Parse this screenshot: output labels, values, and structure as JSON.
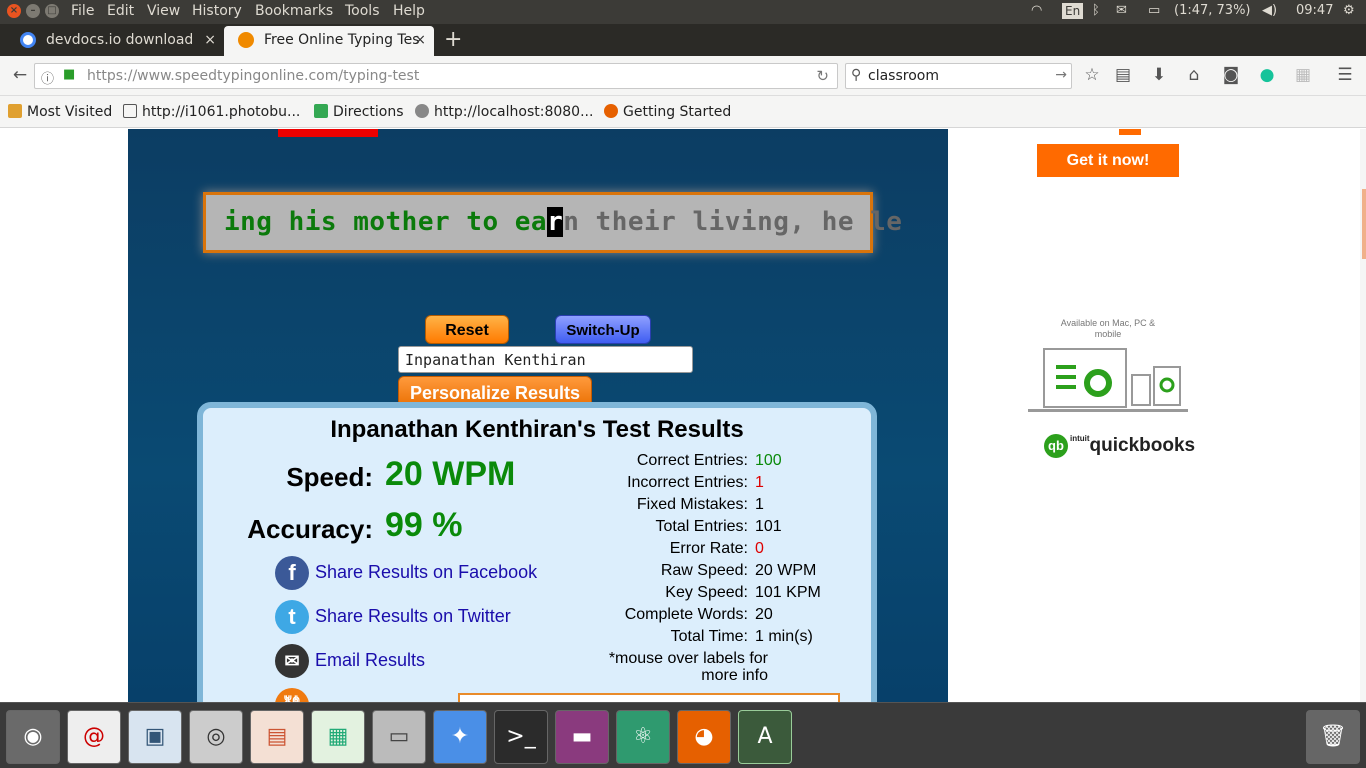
{
  "system_menu": {
    "items": [
      "File",
      "Edit",
      "View",
      "History",
      "Bookmarks",
      "Tools",
      "Help"
    ],
    "tray": {
      "keyboard": "En",
      "battery": "(1:47, 73%)",
      "time": "09:47"
    }
  },
  "tabs": [
    {
      "title": "devdocs.io download",
      "active": false
    },
    {
      "title": "Free Online Typing Tes",
      "active": true
    }
  ],
  "nav": {
    "url_domain": "https://www.speedtypingonline.com",
    "url_path": "/typing-test",
    "search_value": "classroom"
  },
  "bookmarks": [
    "Most Visited",
    "http://i1061.photobu...",
    "Directions",
    "http://localhost:8080...",
    "Getting Started"
  ],
  "typing": {
    "typed": "ing his mother to ea",
    "cursor_char": "r",
    "remaining": "n their living, he le"
  },
  "controls": {
    "reset_label": "Reset",
    "switch_label": "Switch-Up",
    "name_value": "Inpanathan Kenthiran",
    "personalize_label": "Personalize Results"
  },
  "results": {
    "title": "Inpanathan Kenthiran's Test Results",
    "speed_label": "Speed:",
    "speed_value": "20 WPM",
    "accuracy_label": "Accuracy:",
    "accuracy_value": "99 %",
    "share_facebook": "Share Results on Facebook",
    "share_twitter": "Share Results on Twitter",
    "email": "Email Results",
    "stats": [
      {
        "label": "Correct Entries:",
        "value": "100",
        "color": "green"
      },
      {
        "label": "Incorrect Entries:",
        "value": "1",
        "color": "red"
      },
      {
        "label": "Fixed Mistakes:",
        "value": "1",
        "color": ""
      },
      {
        "label": "Total Entries:",
        "value": "101",
        "color": ""
      },
      {
        "label": "Error Rate:",
        "value": "0",
        "color": "red"
      },
      {
        "label": "Raw Speed:",
        "value": "20 WPM",
        "color": ""
      },
      {
        "label": "Key Speed:",
        "value": "101 KPM",
        "color": ""
      },
      {
        "label": "Complete Words:",
        "value": "20",
        "color": ""
      },
      {
        "label": "Total Time:",
        "value": "1 min(s)",
        "color": ""
      }
    ],
    "mouse_note": "*mouse over labels for more info"
  },
  "ad": {
    "get_it": "Get it now!",
    "available": "Available on Mac, PC & mobile",
    "brand_prefix": "intuit",
    "brand": "quickbooks"
  }
}
